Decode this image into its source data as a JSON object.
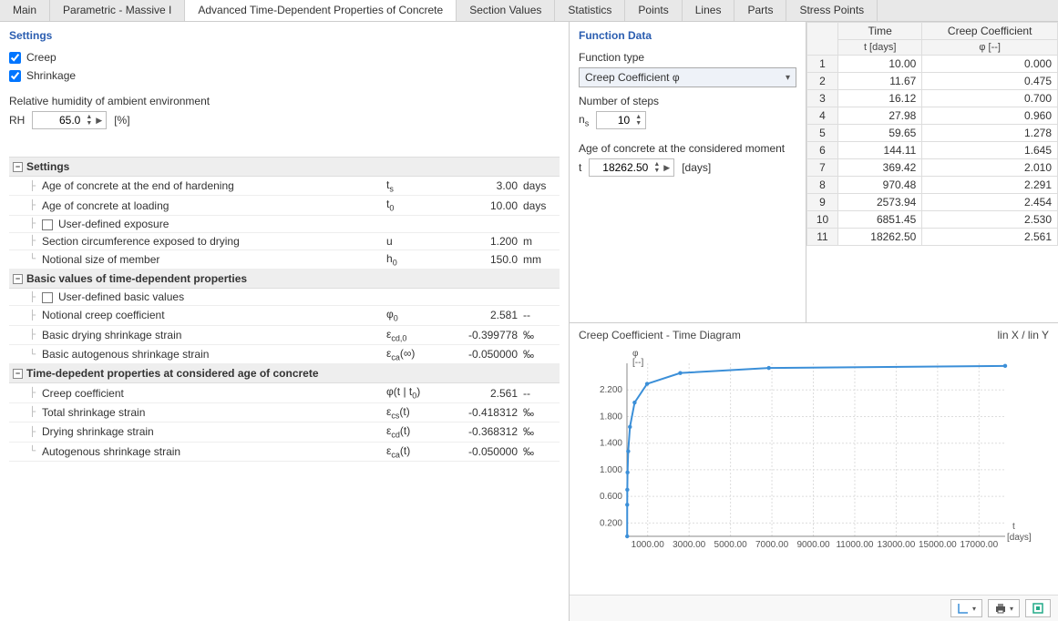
{
  "tabs": [
    "Main",
    "Parametric - Massive I",
    "Advanced Time-Dependent Properties of Concrete",
    "Section Values",
    "Statistics",
    "Points",
    "Lines",
    "Parts",
    "Stress Points"
  ],
  "active_tab_index": 2,
  "settings_panel": {
    "title": "Settings",
    "creep_label": "Creep",
    "creep_checked": true,
    "shrinkage_label": "Shrinkage",
    "shrinkage_checked": true,
    "rh_label": "Relative humidity of ambient environment",
    "rh_sym": "RH",
    "rh_value": "65.0",
    "rh_unit": "[%]"
  },
  "prop_grid": {
    "groups": [
      {
        "title": "Settings",
        "rows": [
          {
            "label": "Age of concrete at the end of hardening",
            "sym": "t<sub>s</sub>",
            "val": "3.00",
            "unit": "days"
          },
          {
            "label": "Age of concrete at loading",
            "sym": "t<sub>0</sub>",
            "val": "10.00",
            "unit": "days"
          },
          {
            "label": "User-defined exposure",
            "check": true,
            "sym": "",
            "val": "",
            "unit": ""
          },
          {
            "label": "Section circumference exposed to drying",
            "sym": "u",
            "val": "1.200",
            "unit": "m"
          },
          {
            "label": "Notional size of member",
            "sym": "h<sub>0</sub>",
            "val": "150.0",
            "unit": "mm"
          }
        ]
      },
      {
        "title": "Basic values of time-dependent properties",
        "rows": [
          {
            "label": "User-defined basic values",
            "check": true,
            "sym": "",
            "val": "",
            "unit": ""
          },
          {
            "label": "Notional creep coefficient",
            "sym": "φ<sub>0</sub>",
            "val": "2.581",
            "unit": "--"
          },
          {
            "label": "Basic drying shrinkage strain",
            "sym": "ε<sub>cd,0</sub>",
            "val": "-0.399778",
            "unit": "‰"
          },
          {
            "label": "Basic autogenous shrinkage strain",
            "sym": "ε<sub>ca</sub>(∞)",
            "val": "-0.050000",
            "unit": "‰"
          }
        ]
      },
      {
        "title": "Time-depedent properties at considered age of concrete",
        "rows": [
          {
            "label": "Creep coefficient",
            "sym": "φ(t | t<sub>0</sub>)",
            "val": "2.561",
            "unit": "--"
          },
          {
            "label": "Total shrinkage strain",
            "sym": "ε<sub>cs</sub>(t)",
            "val": "-0.418312",
            "unit": "‰"
          },
          {
            "label": "Drying shrinkage strain",
            "sym": "ε<sub>cd</sub>(t)",
            "val": "-0.368312",
            "unit": "‰"
          },
          {
            "label": "Autogenous shrinkage strain",
            "sym": "ε<sub>ca</sub>(t)",
            "val": "-0.050000",
            "unit": "‰"
          }
        ]
      }
    ]
  },
  "function_data": {
    "title": "Function Data",
    "type_label": "Function type",
    "type_value": "Creep Coefficient φ",
    "steps_label": "Number of steps",
    "steps_sym": "n<sub>s</sub>",
    "steps_value": "10",
    "age_label": "Age of concrete at the considered moment",
    "age_sym": "t",
    "age_value": "18262.50",
    "age_unit": "[days]"
  },
  "table": {
    "col1_top": "Time",
    "col1_sub": "t [days]",
    "col2_top": "Creep Coefficient",
    "col2_sub": "φ [--]",
    "rows": [
      {
        "i": "1",
        "t": "10.00",
        "c": "0.000"
      },
      {
        "i": "2",
        "t": "11.67",
        "c": "0.475"
      },
      {
        "i": "3",
        "t": "16.12",
        "c": "0.700"
      },
      {
        "i": "4",
        "t": "27.98",
        "c": "0.960"
      },
      {
        "i": "5",
        "t": "59.65",
        "c": "1.278"
      },
      {
        "i": "6",
        "t": "144.11",
        "c": "1.645"
      },
      {
        "i": "7",
        "t": "369.42",
        "c": "2.010"
      },
      {
        "i": "8",
        "t": "970.48",
        "c": "2.291"
      },
      {
        "i": "9",
        "t": "2573.94",
        "c": "2.454"
      },
      {
        "i": "10",
        "t": "6851.45",
        "c": "2.530"
      },
      {
        "i": "11",
        "t": "18262.50",
        "c": "2.561"
      }
    ]
  },
  "chart": {
    "title": "Creep Coefficient - Time Diagram",
    "scale_label": "lin X / lin Y",
    "y_sym": "φ",
    "y_unit": "[--]",
    "x_sym": "t",
    "x_unit": "[days]"
  },
  "chart_data": {
    "type": "line",
    "title": "Creep Coefficient - Time Diagram",
    "xlabel": "t [days]",
    "ylabel": "φ [--]",
    "xlim": [
      0,
      18262.5
    ],
    "ylim": [
      0,
      2.6
    ],
    "x_ticks": [
      1000,
      3000,
      5000,
      7000,
      9000,
      11000,
      13000,
      15000,
      17000
    ],
    "y_ticks": [
      0.2,
      0.6,
      1.0,
      1.4,
      1.8,
      2.2
    ],
    "x": [
      10.0,
      11.67,
      16.12,
      27.98,
      59.65,
      144.11,
      369.42,
      970.48,
      2573.94,
      6851.45,
      18262.5
    ],
    "y": [
      0.0,
      0.475,
      0.7,
      0.96,
      1.278,
      1.645,
      2.01,
      2.291,
      2.454,
      2.53,
      2.561
    ]
  },
  "toolbar": {
    "axes_btn": "axes",
    "print_btn": "print",
    "export_btn": "export"
  }
}
